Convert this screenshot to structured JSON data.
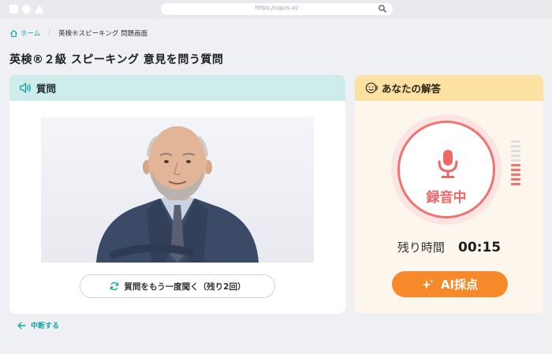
{
  "browser": {
    "url": "https://uguis.ai/"
  },
  "breadcrumb": {
    "home": "ホーム",
    "separator": "/",
    "current": "英検®スピーキング 問題画面"
  },
  "page": {
    "title": "英検®２級 スピーキング 意見を問う質問"
  },
  "question_panel": {
    "title": "質問",
    "icon": "speaker-icon",
    "replay_label": "質問をもう一度聞く（残り2回）"
  },
  "answer_panel": {
    "title": "あなたの解答",
    "icon": "smile-icon",
    "recording_label": "録音中",
    "time_label": "残り時間",
    "time_value": "00:15",
    "ai_button_label": "AI採点",
    "level_meter": {
      "bars": 10,
      "active": 5
    }
  },
  "footer": {
    "back_label": "中断する"
  },
  "colors": {
    "teal": "#1aa3a3",
    "question_header": "#cdeceb",
    "answer_header": "#fde1a2",
    "answer_bg": "#fdf6ec",
    "record_red": "#f07272",
    "ai_orange": "#f6892a"
  }
}
